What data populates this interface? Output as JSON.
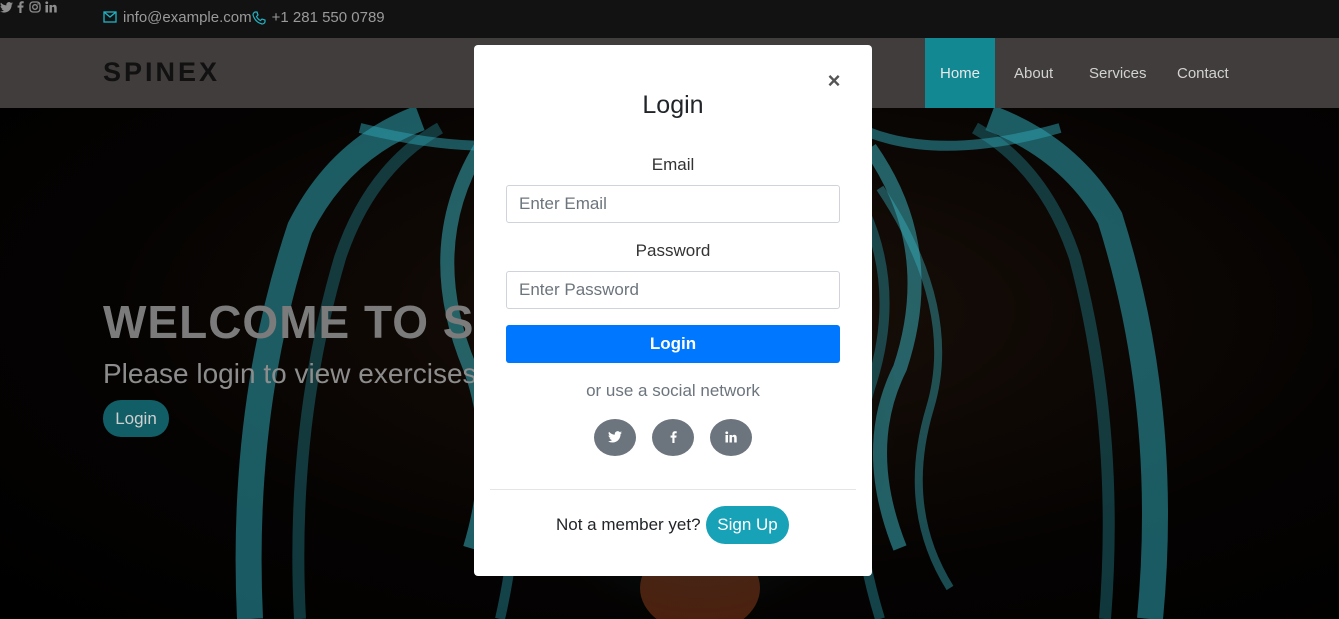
{
  "topbar": {
    "email": "info@example.com",
    "phone": "+1 281 550 0789",
    "social": [
      {
        "name": "twitter-icon",
        "glyph": "t"
      },
      {
        "name": "facebook-icon",
        "glyph": "f"
      },
      {
        "name": "instagram-icon",
        "glyph": "◎"
      },
      {
        "name": "linkedin-icon",
        "glyph": "in"
      }
    ]
  },
  "navbar": {
    "brand": "SPINEX",
    "items": [
      {
        "label": "Home",
        "active": true
      },
      {
        "label": "About",
        "active": false
      },
      {
        "label": "Services",
        "active": false
      },
      {
        "label": "Contact",
        "active": false
      }
    ]
  },
  "hero": {
    "title": "WELCOME TO SPINEX",
    "subtitle": "Please login to view exercises",
    "button": "Login"
  },
  "modal": {
    "title": "Login",
    "close": "×",
    "email_label": "Email",
    "email_placeholder": "Enter Email",
    "password_label": "Password",
    "password_placeholder": "Enter Password",
    "login_button": "Login",
    "social_text": "or use a social network",
    "social": [
      {
        "name": "twitter-icon",
        "glyph": "t"
      },
      {
        "name": "facebook-icon",
        "glyph": "f"
      },
      {
        "name": "linkedin-icon",
        "glyph": "in"
      }
    ],
    "member_text": "Not a member yet?",
    "signup_button": "Sign Up"
  },
  "colors": {
    "accent": "#128893",
    "primary": "#0077ff",
    "info": "#17a2b8",
    "social_btn": "#6c757d"
  }
}
